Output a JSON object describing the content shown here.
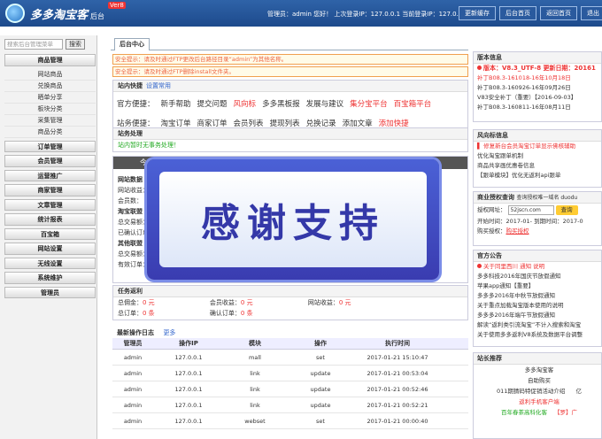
{
  "header": {
    "logo_text": "多多淘宝客",
    "logo_sub": "后台",
    "logo_ver": "Ver8",
    "info": "管理员：admin 您好！ 上次登录IP：127.0.0.1  当前登录IP：127.0.0.1",
    "buttons": [
      "更新缓存",
      "后台首页",
      "返回首页",
      "退出"
    ]
  },
  "sidebar": {
    "search_placeholder": "搜索后台管理菜单",
    "search_btn": "搜索",
    "groups": [
      {
        "label": "商品管理",
        "items": [
          "网站商品",
          "兑换商品",
          "晒单分享",
          "板块分类",
          "采集管理",
          "商品分类"
        ]
      },
      {
        "label": "订单管理",
        "items": []
      },
      {
        "label": "会员管理",
        "items": []
      },
      {
        "label": "运营推广",
        "items": []
      },
      {
        "label": "商家管理",
        "items": []
      },
      {
        "label": "文章管理",
        "items": []
      },
      {
        "label": "统计报表",
        "items": []
      },
      {
        "label": "百宝箱",
        "items": []
      },
      {
        "label": "网站设置",
        "items": []
      },
      {
        "label": "无线设置",
        "items": []
      },
      {
        "label": "系统维护",
        "items": []
      },
      {
        "label": "管理员",
        "items": []
      }
    ]
  },
  "main": {
    "tab": "后台中心",
    "warnings": [
      "安全提示：请及时通过FTP更改后台路径目录“admin”为其他名称。",
      "安全提示：请及时通过FTP删除install文件夹。"
    ],
    "shortcuts_title": "站内快捷",
    "shortcuts_link": "设置常用",
    "row1_label": "官方便捷：",
    "row1": [
      "新手帮助",
      "提交问题",
      "风向标",
      "多多黑板报",
      "发展与建议",
      "集分宝平台",
      "百宝箱平台"
    ],
    "row2_label": "站务便捷：",
    "row2": [
      "淘宝订单",
      "商家订单",
      "会员列表",
      "提现列表",
      "兑换记录",
      "添加文章",
      "添加快捷"
    ],
    "process_title": "站务处理",
    "process_text": "站内暂时无事务处理！",
    "today": "今",
    "stats_site": "网站数据",
    "stats_site_rows": [
      "网站收益：",
      "会员数："
    ],
    "stats_taobao": "淘宝联盟",
    "stats_taobao_rows": [
      "总交易额：",
      "已确认订单："
    ],
    "stats_other": "其他联盟",
    "stats_other_rows": [
      "总交易额：",
      "有效订单："
    ],
    "task_title": "任务返利",
    "task_row1": [
      "总佣金：",
      "0 元",
      "会员收益：",
      "0 元",
      "网站收益：",
      "0 元"
    ],
    "task_row2": [
      "总订单：",
      "0 条",
      "确认订单：",
      "0 条"
    ],
    "log_title": "最新操作日志",
    "log_more": "更多",
    "log_headers": [
      "管理员",
      "操作IP",
      "模块",
      "操作",
      "执行时间"
    ],
    "log_rows": [
      [
        "admin",
        "127.0.0.1",
        "mall",
        "set",
        "2017-01-21 15:10:47"
      ],
      [
        "admin",
        "127.0.0.1",
        "link",
        "update",
        "2017-01-21 00:53:04"
      ],
      [
        "admin",
        "127.0.0.1",
        "link",
        "update",
        "2017-01-21 00:52:46"
      ],
      [
        "admin",
        "127.0.0.1",
        "link",
        "update",
        "2017-01-21 00:52:21"
      ],
      [
        "admin",
        "127.0.0.1",
        "webset",
        "set",
        "2017-01-21 00:00:40"
      ]
    ],
    "overlay_text": "感谢支持"
  },
  "right": {
    "ver_title": "版本信息",
    "ver_line": "版本：V8.3_UTF-8 更新日期：20161",
    "ver_items": [
      "补丁B08.3-161018-16年10月18日",
      "补丁B08.3-160926-16年09月26日",
      "V83安全补丁（重要）【2016-09-03】",
      "补丁B08.3-160811-16年08月11日"
    ],
    "wind_title": "风向标信息",
    "wind_items": [
      "▌ 修复新台会员淘宝订单显示佛核辅助",
      "优化淘宝跟单机制",
      "商品共享画优惠卷信息",
      "【跟单模块】优化无返利api跟单"
    ],
    "auth_title": "商业授权查询",
    "auth_sub": "查询授权唯一域名 duodu",
    "auth_domain_label": "授权网址：",
    "auth_domain": "52jscn.com",
    "auth_btn": "查询",
    "auth_start": "开始时间：2017-01-",
    "auth_end": "到期时间：2017-0",
    "auth_buy_label": "购买授权：",
    "auth_buy": "购买授权",
    "notice_title": "官方公告",
    "notice_items": [
      "关于同里西川 通知 说明",
      "多多科技2016年国庆节放假通知",
      "苹果app通知【重要】",
      "多多多2016年中秋节放假通知",
      "关于重点加载淘宝版本使用的说明",
      "多多多2016年端午节放假通知",
      "解读“返利类引流淘宝”不计入搜索和淘宝",
      "关于使用多多返利V8系统及数据平台调整"
    ],
    "recommend_title": "站长推荐",
    "recommend_items": [
      "多多淘宝客",
      "自助购买",
      "011期猜码特促销活动介绍",
      "返利手机客户端",
      "百年春茶高科化客"
    ],
    "recommend_side": [
      "亿",
      "【罗】广"
    ]
  }
}
